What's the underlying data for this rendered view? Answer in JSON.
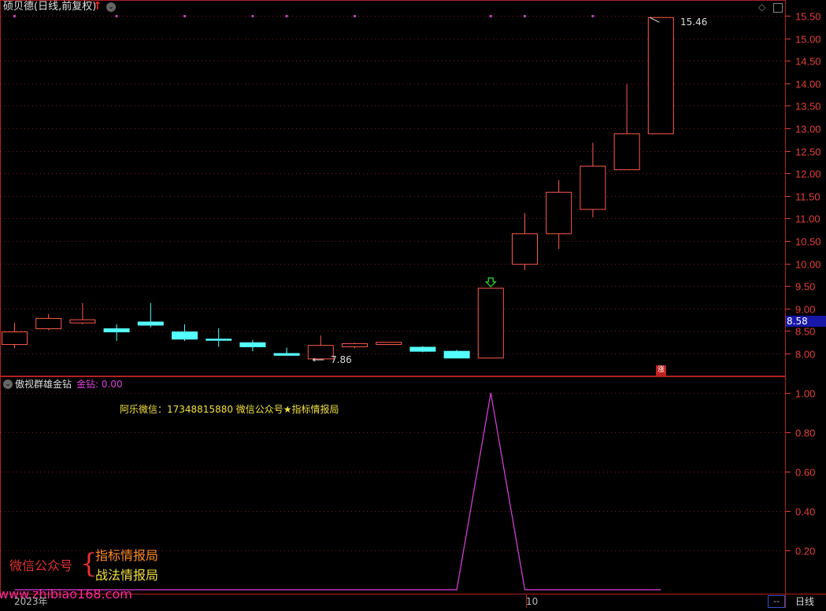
{
  "header": {
    "stock_title": "硕贝德(日线,前复权)",
    "up_arrow_icon": "red-up-arrow-icon",
    "collapse_icon": "chevron-down-icon"
  },
  "price_panel": {
    "current_price_badge": "8.58",
    "high_label": "15.46",
    "low_label": "7.86",
    "zhang_badge": "涨"
  },
  "indicator_panel": {
    "name": "傲视群雄金钻",
    "value_text": "金钻: 0.00",
    "promo_text": "阿乐微信：17348815880    微信公众号★指标情报局"
  },
  "watermark": {
    "left_label": "微信公众号",
    "line1": "指标情报局",
    "line2": "战法情报局",
    "url": "www.zhibiao168.com"
  },
  "bottom_bar": {
    "year_label": "2023年",
    "month_label": "10",
    "dash_label": "--",
    "period_button": "日线"
  },
  "colors": {
    "up": "#ff5a4a",
    "down": "#54ffff",
    "axis": "#e0403a",
    "indicator_line": "#e040e0",
    "marker": "#c040c0"
  },
  "chart_data": [
    {
      "type": "candlestick",
      "yaxis_ticks": [
        "15.50",
        "15.00",
        "14.50",
        "14.00",
        "13.50",
        "13.00",
        "12.50",
        "12.00",
        "11.50",
        "11.00",
        "10.50",
        "10.00",
        "9.50",
        "9.00",
        "8.50",
        "8.00"
      ],
      "ylim": [
        7.6,
        15.85
      ],
      "candles": [
        {
          "o": 8.2,
          "h": 8.68,
          "l": 8.12,
          "c": 8.48
        },
        {
          "o": 8.55,
          "h": 8.88,
          "l": 8.52,
          "c": 8.78
        },
        {
          "o": 8.68,
          "h": 9.12,
          "l": 8.65,
          "c": 8.75
        },
        {
          "o": 8.55,
          "h": 8.65,
          "l": 8.28,
          "c": 8.48
        },
        {
          "o": 8.7,
          "h": 9.12,
          "l": 8.58,
          "c": 8.63
        },
        {
          "o": 8.48,
          "h": 8.65,
          "l": 8.28,
          "c": 8.32
        },
        {
          "o": 8.32,
          "h": 8.56,
          "l": 8.15,
          "c": 8.3
        },
        {
          "o": 8.24,
          "h": 8.3,
          "l": 8.05,
          "c": 8.15
        },
        {
          "o": 8.0,
          "h": 8.13,
          "l": 7.96,
          "c": 7.96
        },
        {
          "o": 7.88,
          "h": 8.4,
          "l": 7.86,
          "c": 8.18
        },
        {
          "o": 8.15,
          "h": 8.24,
          "l": 8.12,
          "c": 8.22
        },
        {
          "o": 8.2,
          "h": 8.26,
          "l": 8.2,
          "c": 8.25
        },
        {
          "o": 8.14,
          "h": 8.16,
          "l": 8.03,
          "c": 8.05
        },
        {
          "o": 8.05,
          "h": 8.08,
          "l": 7.9,
          "c": 7.9
        },
        {
          "o": 7.9,
          "h": 9.45,
          "l": 7.9,
          "c": 9.45
        },
        {
          "o": 9.98,
          "h": 11.12,
          "l": 9.85,
          "c": 10.66
        },
        {
          "o": 10.66,
          "h": 11.85,
          "l": 10.32,
          "c": 11.58
        },
        {
          "o": 11.2,
          "h": 12.68,
          "l": 11.02,
          "c": 12.16
        },
        {
          "o": 12.08,
          "h": 13.98,
          "l": 12.08,
          "c": 12.88
        },
        {
          "o": 12.88,
          "h": 15.46,
          "l": 12.88,
          "c": 15.46
        }
      ]
    },
    {
      "type": "line",
      "name": "金钻",
      "yaxis_ticks": [
        "1.00",
        "0.80",
        "0.60",
        "0.40",
        "0.20"
      ],
      "ylim": [
        0,
        1.0
      ],
      "values": [
        0,
        0,
        0,
        0,
        0,
        0,
        0,
        0,
        0,
        0,
        0,
        0,
        0,
        0,
        1,
        0,
        0,
        0,
        0,
        0
      ]
    }
  ]
}
